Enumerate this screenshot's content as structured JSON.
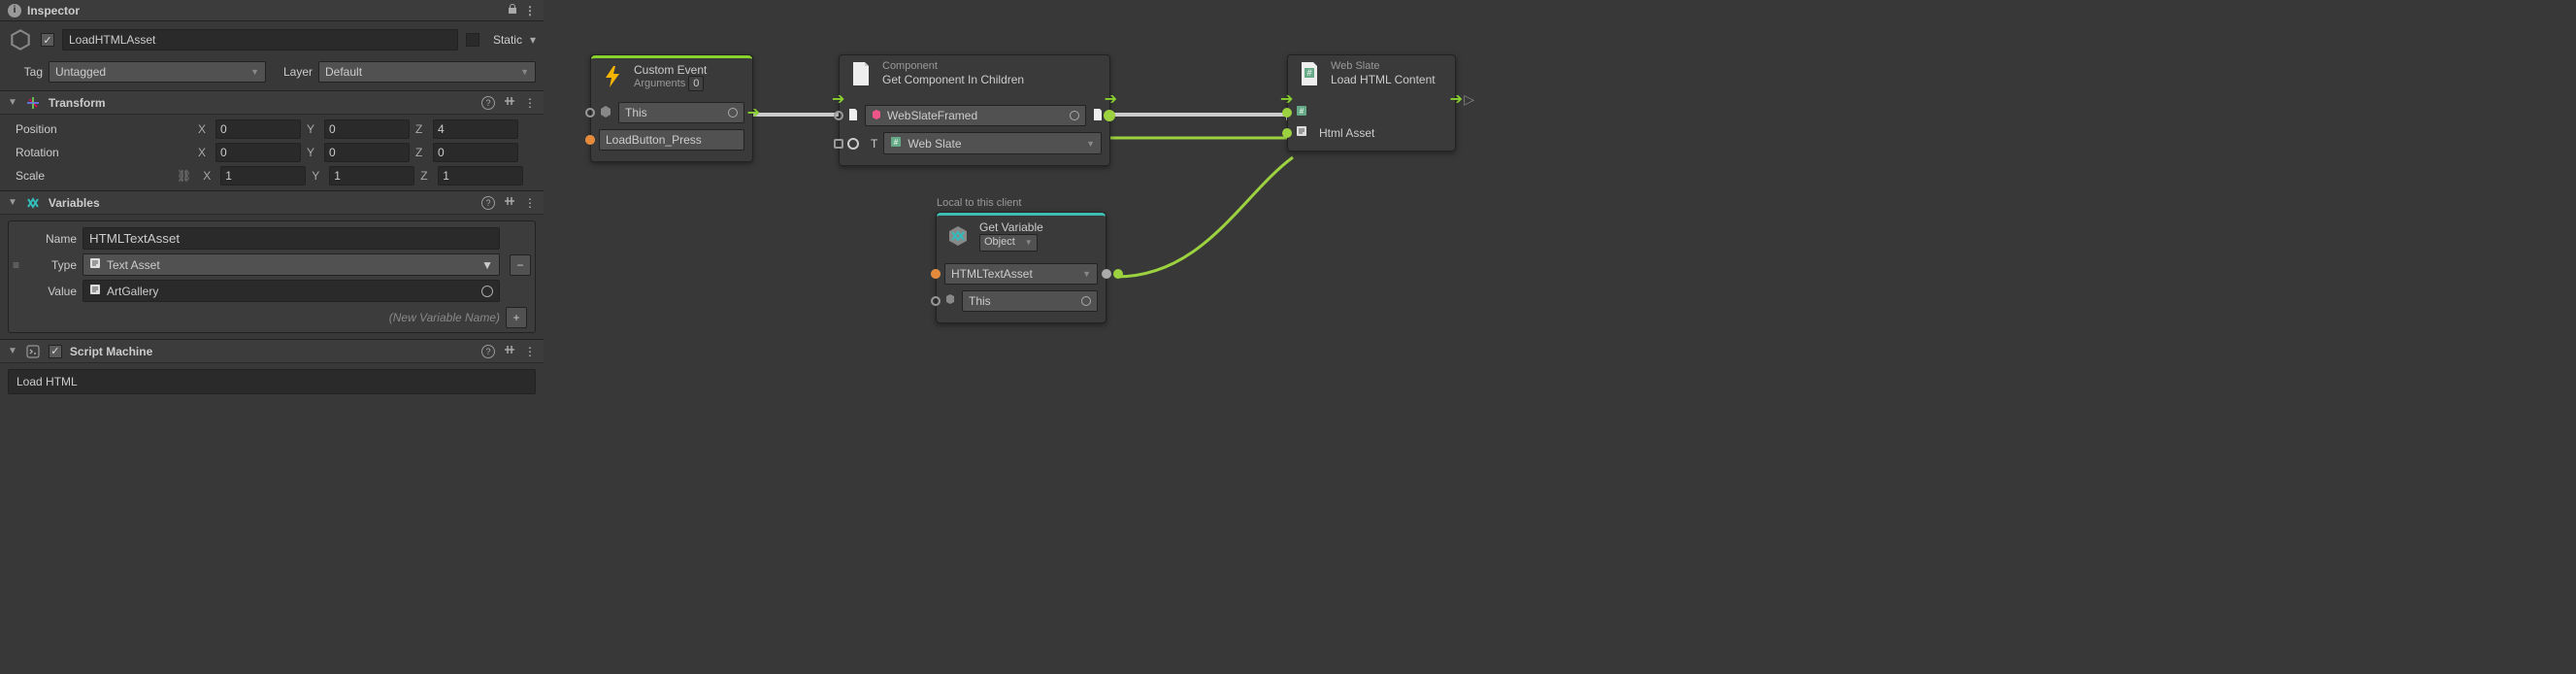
{
  "inspector": {
    "title": "Inspector",
    "go": {
      "enabled": true,
      "name": "LoadHTMLAsset",
      "static_label": "Static"
    },
    "tag": {
      "label": "Tag",
      "value": "Untagged"
    },
    "layer": {
      "label": "Layer",
      "value": "Default"
    },
    "transform": {
      "title": "Transform",
      "position": {
        "label": "Position",
        "x": "0",
        "y": "0",
        "z": "4"
      },
      "rotation": {
        "label": "Rotation",
        "x": "0",
        "y": "0",
        "z": "0"
      },
      "scale": {
        "label": "Scale",
        "x": "1",
        "y": "1",
        "z": "1"
      }
    },
    "variables": {
      "title": "Variables",
      "rows": [
        {
          "name_label": "Name",
          "name": "HTMLTextAsset",
          "type_label": "Type",
          "type": "Text Asset",
          "value_label": "Value",
          "value": "ArtGallery"
        }
      ],
      "new_hint": "(New Variable Name)"
    },
    "script_machine": {
      "title": "Script Machine",
      "graph_name": "Load HTML"
    }
  },
  "graph": {
    "nodes": {
      "custom_event": {
        "title": "Custom Event",
        "subtitle": "Arguments",
        "arguments": "0",
        "target_field": "This",
        "event_name": "LoadButton_Press"
      },
      "get_component": {
        "category": "Component",
        "title": "Get Component In Children",
        "target_field": "WebSlateFramed",
        "type_label": "T",
        "type_value": "Web Slate"
      },
      "load_html": {
        "category": "Web Slate",
        "title": "Load HTML Content",
        "asset_label": "Html Asset"
      },
      "get_variable": {
        "title": "Get Variable",
        "kind": "Object",
        "var_name": "HTMLTextAsset",
        "source": "This",
        "local_tag": "Local to this client"
      }
    }
  }
}
